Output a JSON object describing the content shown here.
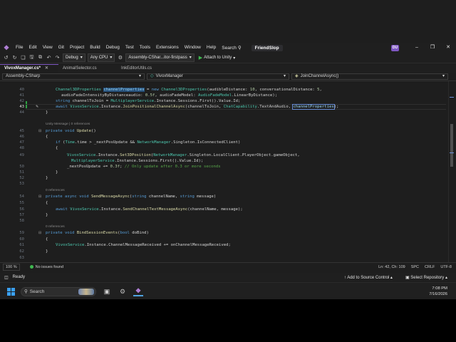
{
  "titlebar": {
    "menu": [
      "File",
      "Edit",
      "View",
      "Git",
      "Project",
      "Build",
      "Debug",
      "Test",
      "Tools",
      "Extensions",
      "Window",
      "Help"
    ],
    "search_label": "Search",
    "solution": "FriendSlop",
    "user_initials": "DU"
  },
  "toolbar": {
    "config": "Debug",
    "platform": "Any CPU",
    "project": "Assembly-CShar...itor-firstpass",
    "attach_label": "Attach to Unity"
  },
  "tabs": [
    {
      "label": "VivoxManager.cs*",
      "active": true
    },
    {
      "label": "AnimalSelector.cs",
      "active": false
    },
    {
      "label": "InkEditorUtils.cs",
      "active": false
    }
  ],
  "navbar": {
    "project": "Assembly-CSharp",
    "class": "VivoxManager",
    "member": "JoinChannelAsync()"
  },
  "editor": {
    "line_numbers": {
      "l40": "40",
      "l41": "41",
      "l42": "42",
      "l43": "43",
      "l44": "44",
      "l45": "45",
      "l46": "46",
      "l47": "47",
      "l48": "48",
      "l49": "49",
      "l50": "50",
      "l51": "51",
      "l52": "52",
      "l53": "53",
      "l54": "54",
      "l55": "55",
      "l56": "56",
      "l57": "57",
      "l58": "58",
      "l59": "59",
      "l60": "60",
      "l61": "61",
      "l62": "62",
      "l63": "63"
    },
    "lens": {
      "update": "Unity Message | 0 references",
      "send": "0 references",
      "bind": "0 references"
    },
    "current_line": 42
  },
  "editor_status": {
    "zoom": "100 %",
    "issues": "No issues found",
    "position": "Ln: 42, Ch: 109",
    "indent": "SPC",
    "line_ending": "CRLF",
    "encoding": "UTF-8"
  },
  "statusbar": {
    "ready": "Ready",
    "source_control": "Add to Source Control",
    "repository": "Select Repository"
  },
  "taskbar": {
    "search_placeholder": "Search",
    "time": "7:08 PM",
    "date": "7/16/2026"
  },
  "colors": {
    "accent": "#7e57c2",
    "keyword": "#569cd6",
    "type": "#4ec9b0",
    "method": "#dcdcaa",
    "comment": "#57a64a"
  }
}
